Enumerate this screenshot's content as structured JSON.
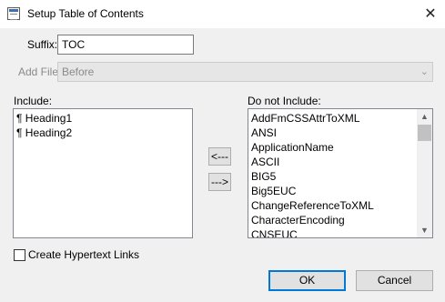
{
  "window": {
    "title": "Setup Table of Contents",
    "close_symbol": "✕",
    "app_icon": "dialog-window-icon"
  },
  "suffix": {
    "label": "Suffix:",
    "value": "TOC"
  },
  "add_file": {
    "label": "Add File:",
    "selected": "Before",
    "enabled": false
  },
  "include": {
    "label": "Include:",
    "items": [
      "¶ Heading1",
      "¶ Heading2"
    ]
  },
  "exclude": {
    "label": "Do not Include:",
    "items": [
      "AddFmCSSAttrToXML",
      "ANSI",
      "ApplicationName",
      "ASCII",
      "BIG5",
      "Big5EUC",
      "ChangeReferenceToXML",
      "CharacterEncoding",
      "CNSEUC"
    ]
  },
  "move_left_button": "<---",
  "move_right_button": "--->",
  "hypertext": {
    "label": "Create Hypertext Links",
    "checked": false
  },
  "ok_button": "OK",
  "cancel_button": "Cancel",
  "colors": {
    "accent": "#0078d7",
    "dialog_bg": "#f0f0f0"
  }
}
